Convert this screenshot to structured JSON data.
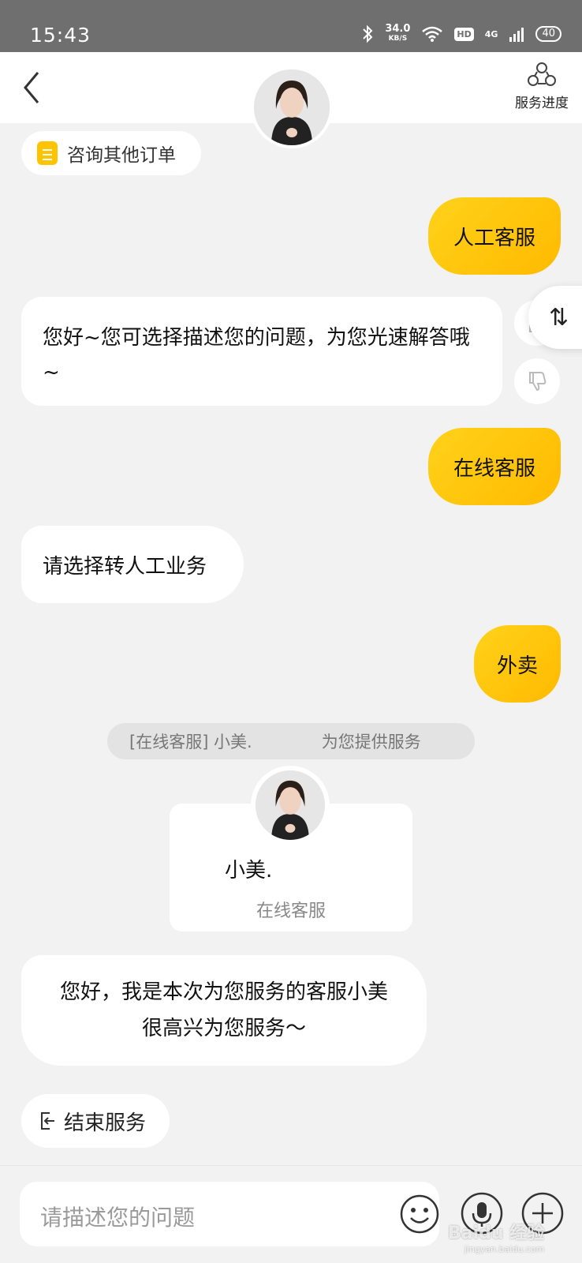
{
  "status_bar": {
    "time": "15:43",
    "speed_value": "34.0",
    "speed_unit": "KB/S",
    "hd": "HD",
    "network": "4G",
    "battery": "40"
  },
  "header": {
    "progress_label": "服务进度"
  },
  "order_chip": {
    "label": "咨询其他订单"
  },
  "messages": [
    {
      "from": "user",
      "text": "人工客服"
    },
    {
      "from": "bot",
      "text": "您好~您可选择描述您的问题，为您光速解答哦~"
    },
    {
      "from": "user",
      "text": "在线客服"
    },
    {
      "from": "bot",
      "text": "请选择转人工业务"
    },
    {
      "from": "user",
      "text": "外卖"
    }
  ],
  "switch_tab": {
    "icon": "⇅"
  },
  "notice": {
    "prefix": "[在线客服] 小美.",
    "suffix": "为您提供服务"
  },
  "agent_card": {
    "name": "小美.",
    "role": "在线客服"
  },
  "agent_message": {
    "line1": "您好，我是本次为您服务的客服小美",
    "line2": "很高兴为您服务～"
  },
  "end_service": {
    "label": "结束服务"
  },
  "composer": {
    "placeholder": "请描述您的问题"
  },
  "watermark": {
    "brand": "Baidu 经验",
    "domain": "jingyan.baidu.com"
  },
  "colors": {
    "accent": "#ffc400",
    "background": "#f2f2f2",
    "status_bar": "#6f6f6f"
  }
}
